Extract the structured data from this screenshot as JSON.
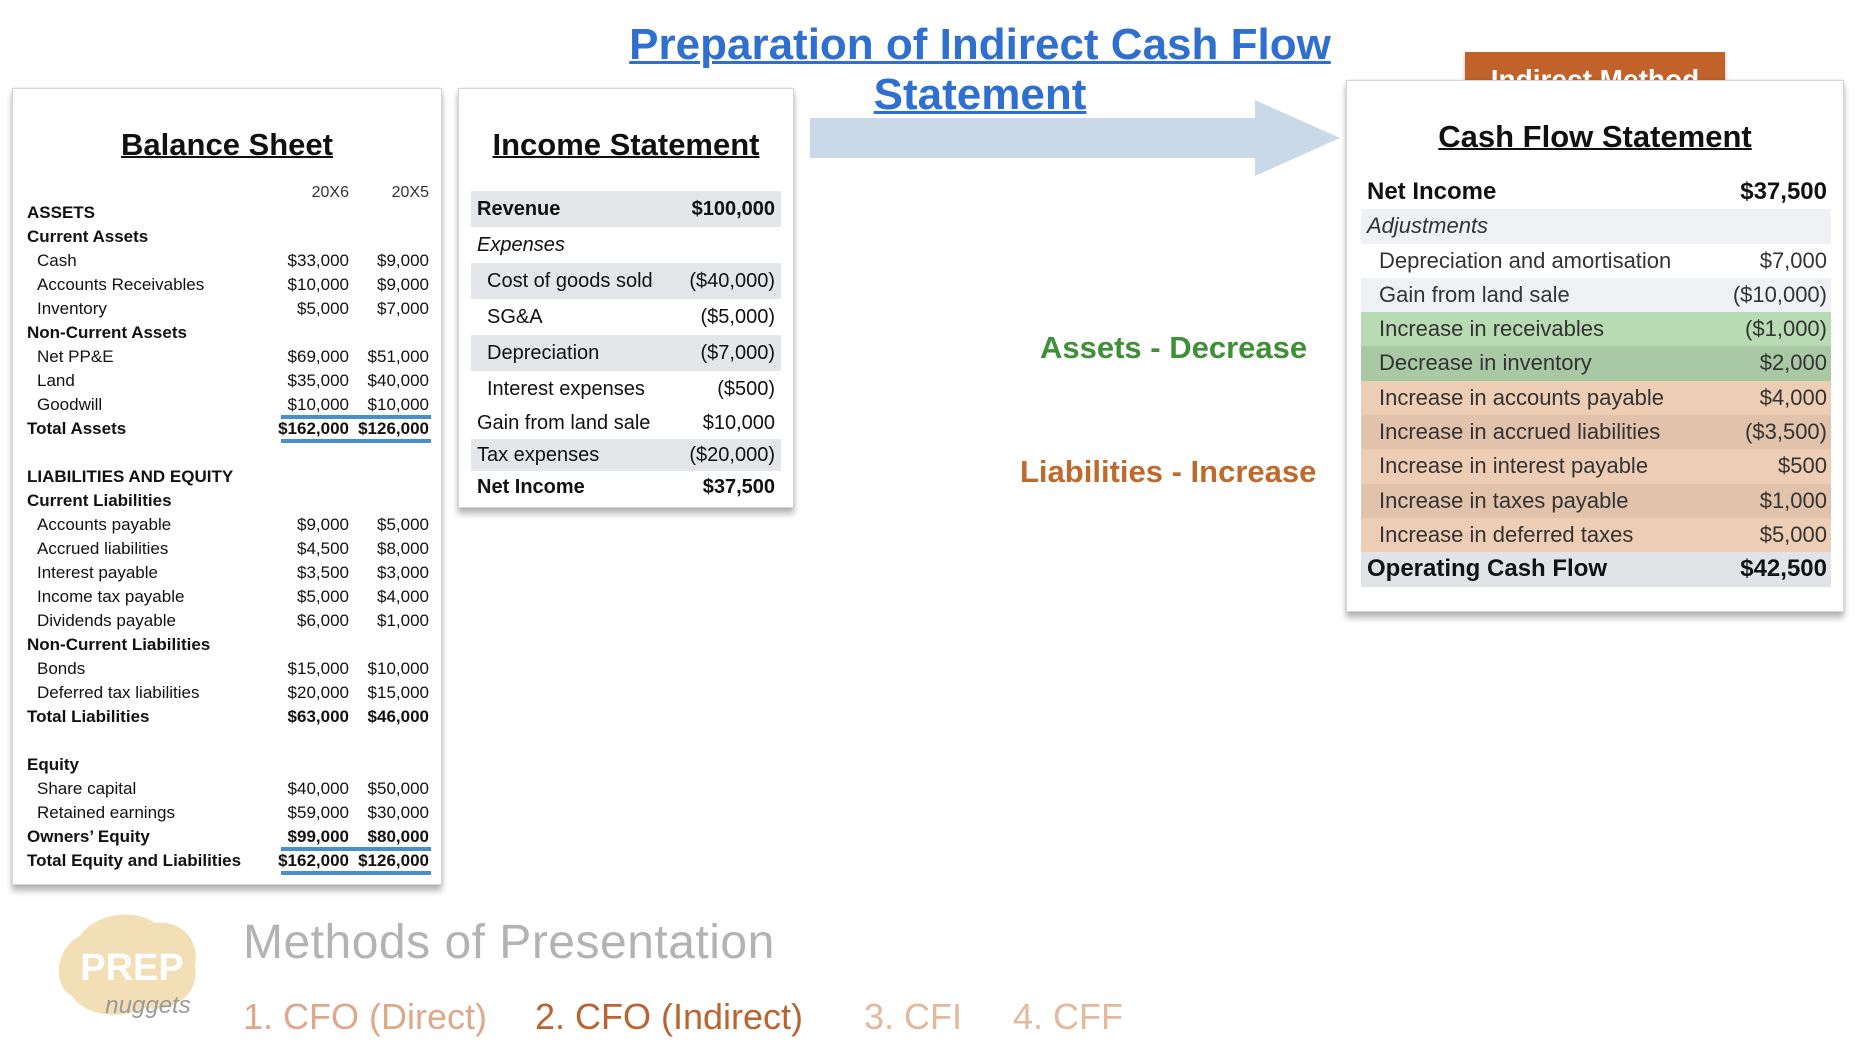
{
  "title": "Preparation of Indirect Cash Flow Statement",
  "balance_sheet": {
    "title": "Balance Sheet",
    "years": [
      "20X6",
      "20X5"
    ],
    "rows": [
      {
        "label": "ASSETS",
        "v1": "",
        "v2": "",
        "style": "section"
      },
      {
        "label": "Current Assets",
        "v1": "",
        "v2": "",
        "style": "section"
      },
      {
        "label": "Cash",
        "v1": "$33,000",
        "v2": "$9,000",
        "style": "item"
      },
      {
        "label": "Accounts Receivables",
        "v1": "$10,000",
        "v2": "$9,000",
        "style": "item"
      },
      {
        "label": "Inventory",
        "v1": "$5,000",
        "v2": "$7,000",
        "style": "item"
      },
      {
        "label": "Non-Current Assets",
        "v1": "",
        "v2": "",
        "style": "section"
      },
      {
        "label": "Net PP&E",
        "v1": "$69,000",
        "v2": "$51,000",
        "style": "item"
      },
      {
        "label": "Land",
        "v1": "$35,000",
        "v2": "$40,000",
        "style": "item"
      },
      {
        "label": "Goodwill",
        "v1": "$10,000",
        "v2": "$10,000",
        "style": "item-line"
      },
      {
        "label": "Total Assets",
        "v1": "$162,000",
        "v2": "$126,000",
        "style": "total-line"
      },
      {
        "label": "",
        "v1": "",
        "v2": "",
        "style": "spacer"
      },
      {
        "label": "LIABILITIES AND EQUITY",
        "v1": "",
        "v2": "",
        "style": "section"
      },
      {
        "label": "Current Liabilities",
        "v1": "",
        "v2": "",
        "style": "section"
      },
      {
        "label": "Accounts payable",
        "v1": "$9,000",
        "v2": "$5,000",
        "style": "item"
      },
      {
        "label": "Accrued liabilities",
        "v1": "$4,500",
        "v2": "$8,000",
        "style": "item"
      },
      {
        "label": "Interest payable",
        "v1": "$3,500",
        "v2": "$3,000",
        "style": "item"
      },
      {
        "label": "Income tax payable",
        "v1": "$5,000",
        "v2": "$4,000",
        "style": "item"
      },
      {
        "label": "Dividends payable",
        "v1": "$6,000",
        "v2": "$1,000",
        "style": "item"
      },
      {
        "label": "Non-Current Liabilities",
        "v1": "",
        "v2": "",
        "style": "section"
      },
      {
        "label": "Bonds",
        "v1": "$15,000",
        "v2": "$10,000",
        "style": "item"
      },
      {
        "label": "Deferred tax liabilities",
        "v1": "$20,000",
        "v2": "$15,000",
        "style": "item"
      },
      {
        "label": "Total Liabilities",
        "v1": "$63,000",
        "v2": "$46,000",
        "style": "total"
      },
      {
        "label": "",
        "v1": "",
        "v2": "",
        "style": "spacer"
      },
      {
        "label": "Equity",
        "v1": "",
        "v2": "",
        "style": "section"
      },
      {
        "label": "Share capital",
        "v1": "$40,000",
        "v2": "$50,000",
        "style": "item"
      },
      {
        "label": "Retained earnings",
        "v1": "$59,000",
        "v2": "$30,000",
        "style": "item"
      },
      {
        "label": "Owners’ Equity",
        "v1": "$99,000",
        "v2": "$80,000",
        "style": "total-line"
      },
      {
        "label": "Total Equity and Liabilities",
        "v1": "$162,000",
        "v2": "$126,000",
        "style": "total-line"
      }
    ]
  },
  "income_statement": {
    "title": "Income Statement",
    "rows": [
      {
        "label": "Revenue",
        "value": "$100,000",
        "style": "bold",
        "shade": true
      },
      {
        "label": "Expenses",
        "value": "",
        "style": "ital",
        "shade": false
      },
      {
        "label": "Cost of goods sold",
        "value": "($40,000)",
        "style": "indent",
        "shade": true
      },
      {
        "label": "SG&A",
        "value": "($5,000)",
        "style": "indent",
        "shade": false
      },
      {
        "label": "Depreciation",
        "value": "($7,000)",
        "style": "indent",
        "shade": true
      },
      {
        "label": "Interest expenses",
        "value": "($500)",
        "style": "indent",
        "shade": false
      },
      {
        "label": "Gain from land sale",
        "value": "$10,000",
        "style": "sm",
        "shade": false
      },
      {
        "label": "Tax expenses",
        "value": "($20,000)",
        "style": "sm",
        "shade": true
      },
      {
        "label": "Net Income",
        "value": "$37,500",
        "style": "bold-sm",
        "shade": false
      }
    ]
  },
  "badge": "Indirect Method",
  "cash_flow_statement": {
    "title": "Cash Flow Statement",
    "rows": [
      {
        "label": "Net Income",
        "value": "$37,500",
        "style": "bold",
        "bg": "white"
      },
      {
        "label": "Adjustments",
        "value": "",
        "style": "ital",
        "bg": "grey1"
      },
      {
        "label": "Depreciation and amortisation",
        "value": "$7,000",
        "style": "indent",
        "bg": "white"
      },
      {
        "label": "Gain from land sale",
        "value": "($10,000)",
        "style": "indent",
        "bg": "grey1"
      },
      {
        "label": "Increase in receivables",
        "value": "($1,000)",
        "style": "indent",
        "bg": "green1"
      },
      {
        "label": "Decrease in inventory",
        "value": "$2,000",
        "style": "indent",
        "bg": "green2"
      },
      {
        "label": "Increase in accounts payable",
        "value": "$4,000",
        "style": "indent",
        "bg": "tan1"
      },
      {
        "label": "Increase in accrued liabilities",
        "value": "($3,500)",
        "style": "indent",
        "bg": "tan2"
      },
      {
        "label": "Increase in interest payable",
        "value": "$500",
        "style": "indent",
        "bg": "tan1"
      },
      {
        "label": "Increase in taxes payable",
        "value": "$1,000",
        "style": "indent",
        "bg": "tan2"
      },
      {
        "label": "Increase in deferred taxes",
        "value": "$5,000",
        "style": "indent",
        "bg": "tan1"
      },
      {
        "label": "Operating Cash Flow",
        "value": "$42,500",
        "style": "bold",
        "bg": "grey2"
      }
    ]
  },
  "side_labels": {
    "assets": "Assets - Decrease",
    "liabilities": "Liabilities - Increase"
  },
  "logo": {
    "line1": "PREP",
    "line2": "nuggets"
  },
  "methods_title": "Methods of Presentation",
  "nav": [
    "1. CFO (Direct)",
    "2. CFO (Indirect)",
    "3. CFI",
    "4. CFF"
  ],
  "colors": {
    "title_blue": "#2f6fd0",
    "badge": "#c0622a",
    "assets_green": "#3f8f36",
    "liabilities_orange": "#bd6a2c",
    "highlight_green": "#b9dbb3",
    "highlight_tan": "#edcdb3",
    "underline_blue": "#4a8fc7"
  }
}
